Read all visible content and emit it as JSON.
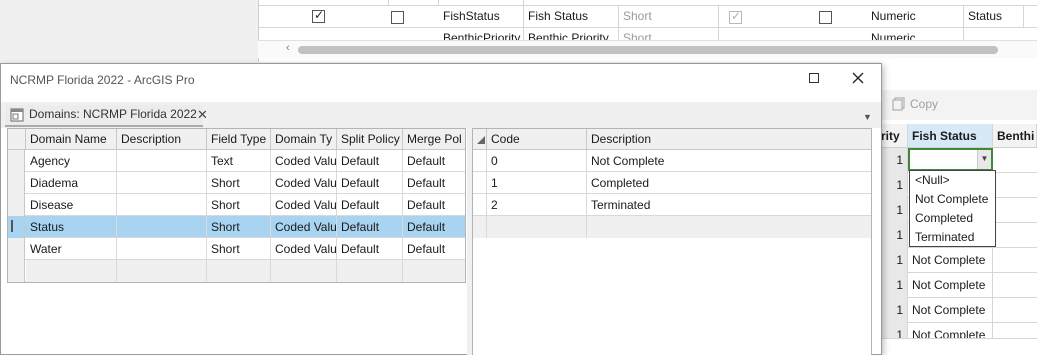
{
  "bg_table": {
    "row1": {
      "name": "FishStatus",
      "alias": "Fish Status",
      "type": "Short",
      "number_format": "Numeric",
      "domain": "Status",
      "checked1": true,
      "checked2": false,
      "checked3": true,
      "checked4": false
    },
    "row2": {
      "name": "BenthicPriority",
      "alias": "Benthic Priority",
      "type": "Short",
      "number_format": "Numeric"
    }
  },
  "right_pane": {
    "copy_label": "Copy",
    "header_prev": "rity",
    "header_fish": "Fish Status",
    "header_next": "Benthi",
    "rows": [
      {
        "num": "1",
        "value": ""
      },
      {
        "num": "1",
        "value": ""
      },
      {
        "num": "1",
        "value": ""
      },
      {
        "num": "1",
        "value": ""
      },
      {
        "num": "1",
        "value": "Not Complete"
      },
      {
        "num": "1",
        "value": "Not Complete"
      },
      {
        "num": "1",
        "value": "Not Complete"
      },
      {
        "num": "1",
        "value": "Not Complete"
      }
    ],
    "dropdown": [
      "<Null>",
      "Not Complete",
      "Completed",
      "Terminated"
    ]
  },
  "dialog": {
    "title": "NCRMP Florida 2022 - ArcGIS Pro",
    "tab_label": "Domains: NCRMP Florida 2022"
  },
  "domains_grid": {
    "headers": [
      "Domain Name",
      "Description",
      "Field Type",
      "Domain Ty",
      "Split Policy",
      "Merge Pol"
    ],
    "rows": [
      [
        "Agency",
        "",
        "Text",
        "Coded Valu",
        "Default",
        "Default"
      ],
      [
        "Diadema",
        "",
        "Short",
        "Coded Valu",
        "Default",
        "Default"
      ],
      [
        "Disease",
        "",
        "Short",
        "Coded Valu",
        "Default",
        "Default"
      ],
      [
        "Status",
        "",
        "Short",
        "Coded Valu",
        "Default",
        "Default"
      ],
      [
        "Water",
        "",
        "Short",
        "Coded Valu",
        "Default",
        "Default"
      ]
    ],
    "selected_index": 3
  },
  "codes_grid": {
    "headers": [
      "Code",
      "Description"
    ],
    "rows": [
      [
        "0",
        "Not Complete"
      ],
      [
        "1",
        "Completed"
      ],
      [
        "2",
        "Terminated"
      ]
    ]
  },
  "colors": {
    "selection": "#a8d4f2",
    "combo_border": "#3a8a3a",
    "header_highlight": "#d7e9f7"
  }
}
